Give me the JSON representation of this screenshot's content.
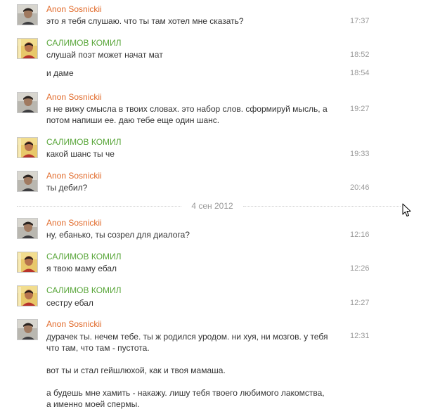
{
  "conversation": {
    "date_separator": "4 сен 2012",
    "messages": [
      {
        "author": "Anon Sosnickii",
        "text": "это я тебя слушаю. что ты там хотел мне сказать?",
        "time": "17:37"
      },
      {
        "author": "САЛИМОВ КОМИЛ",
        "text": "слушай поэт может начат мат",
        "time": "18:52"
      },
      {
        "author": "",
        "text": "и даме",
        "time": "18:54"
      },
      {
        "author": "Anon Sosnickii",
        "text": "я не вижу смысла в твоих словах. это набор слов. сформируй мысль, а\nпотом напиши ее. даю тебе еще один шанс.",
        "time": "19:27"
      },
      {
        "author": "САЛИМОВ КОМИЛ",
        "text": "какой шанс ты че",
        "time": "19:33"
      },
      {
        "author": "Anon Sosnickii",
        "text": "ты дебил?",
        "time": "20:46"
      },
      {
        "author": "Anon Sosnickii",
        "text": "ну, ебанько, ты созрел для диалога?",
        "time": "12:16"
      },
      {
        "author": "САЛИМОВ КОМИЛ",
        "text": "я твою маму ебал",
        "time": "12:26"
      },
      {
        "author": "САЛИМОВ КОМИЛ",
        "text": "сестру ебал",
        "time": "12:27"
      },
      {
        "author": "Anon Sosnickii",
        "text": "дурачек ты. нечем тебе. ты ж родился уродом. ни хуя, ни мозгов. у тебя\nчто там, что там - пустота.\n\nвот ты и стал гейшлюхой, как и твоя мамаша.\n\nа будешь мне хамить - накажу. лишу тебя твоего любимого лакомства,\nа именно моей спермы.",
        "time": "12:31"
      }
    ]
  },
  "colors": {
    "anon_name": "#e16a2a",
    "komil_name": "#59a63a",
    "text": "#333333",
    "time": "#999999"
  },
  "icons": {
    "cursor": "mouse-pointer-icon"
  }
}
